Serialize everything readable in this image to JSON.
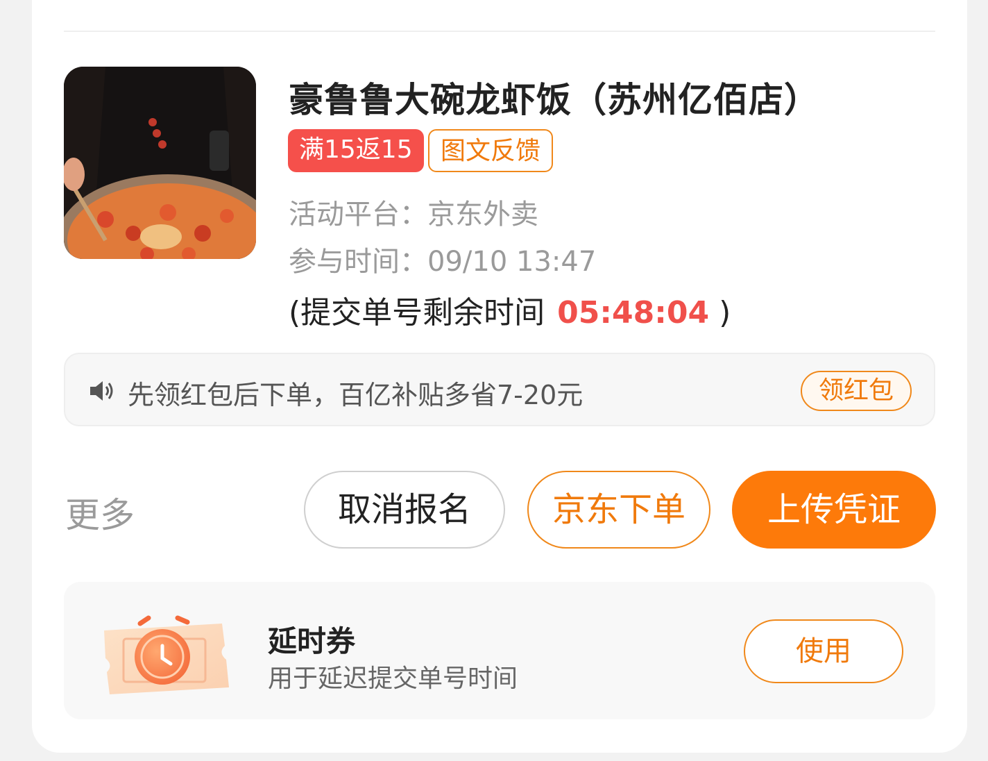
{
  "store": {
    "name": "豪鲁鲁大碗龙虾饭（苏州亿佰店）",
    "tags": [
      "满15返15",
      "图文反馈"
    ],
    "platform_label": "活动平台：",
    "platform_value": "京东外卖",
    "time_label": "参与时间：",
    "time_value": "09/10 13:47",
    "countdown_prefix": "(提交单号剩余时间",
    "countdown_value": "05:48:04",
    "countdown_suffix": ")"
  },
  "notice": {
    "text": "先领红包后下单，百亿补贴多省7-20元",
    "button": "领红包"
  },
  "actions": {
    "more": "更多",
    "cancel": "取消报名",
    "jd_order": "京东下单",
    "upload": "上传凭证"
  },
  "coupon": {
    "title": "延时券",
    "subtitle": "用于延迟提交单号时间",
    "button": "使用"
  },
  "colors": {
    "accent": "#fd7a0a",
    "red": "#f5504b",
    "text": "#222222",
    "muted": "#9a9a9a"
  }
}
